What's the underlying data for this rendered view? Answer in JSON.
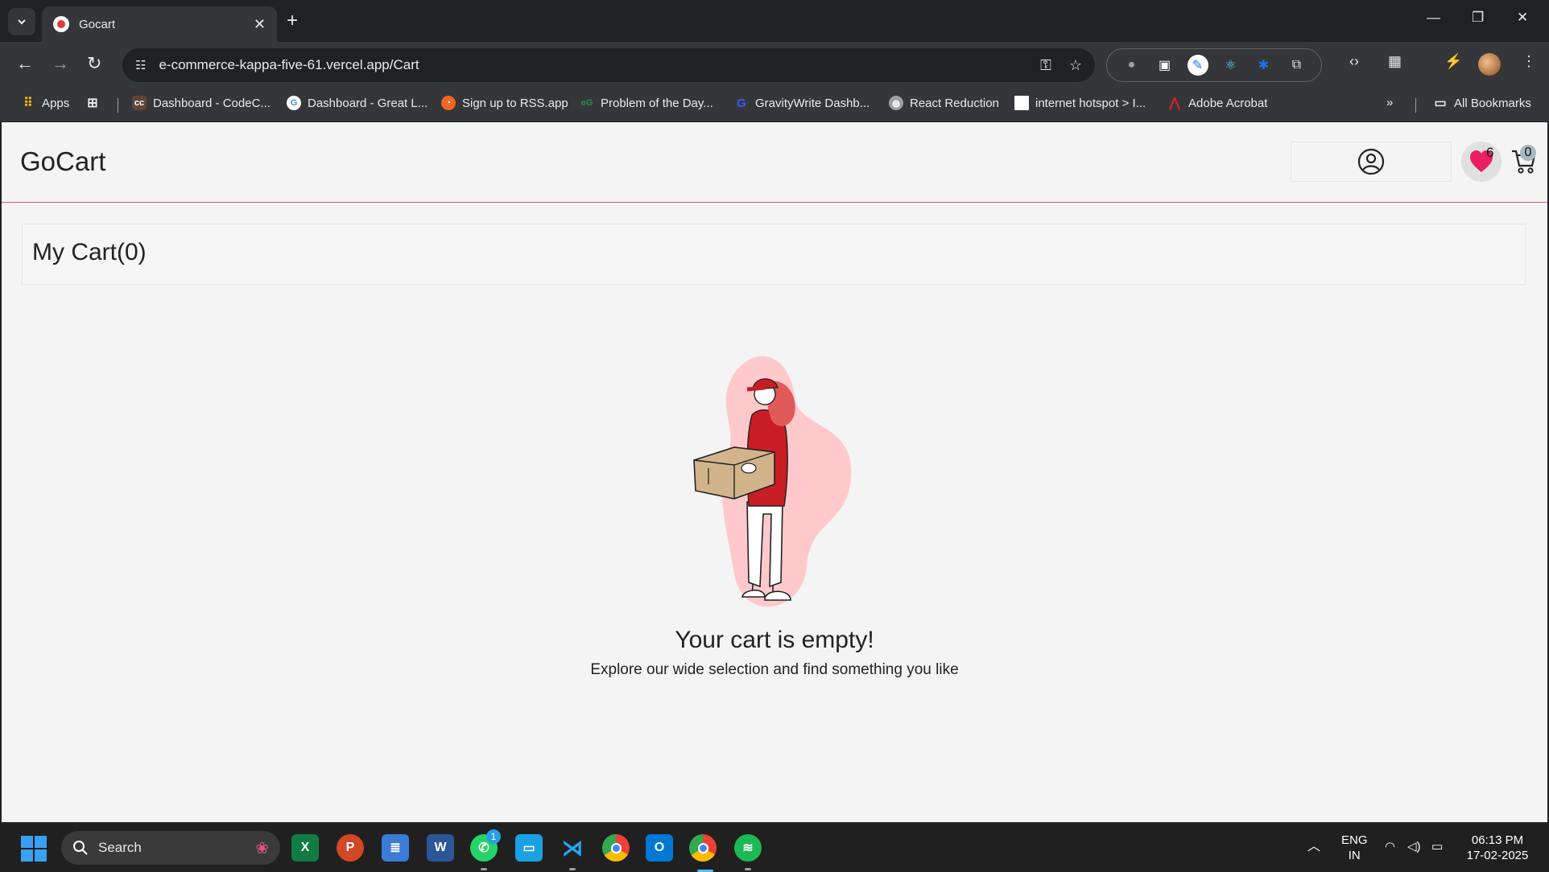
{
  "browser": {
    "tab_title": "Gocart",
    "url": "e-commerce-kappa-five-61.vercel.app/Cart",
    "bookmarks": [
      "Apps",
      "Dashboard - CodeC...",
      "Dashboard - Great L...",
      "Sign up to RSS.app",
      "Problem of the Day...",
      "GravityWrite Dashb...",
      "React Reduction",
      "internet hotspot > I...",
      "Adobe Acrobat"
    ],
    "all_bookmarks": "All Bookmarks"
  },
  "site": {
    "logo": "GoCart",
    "wishlist_count": "6",
    "cart_count": "0"
  },
  "cart": {
    "heading": "My Cart(0)",
    "empty_title": "Your cart is empty!",
    "empty_subtitle": "Explore our wide selection and find something you like"
  },
  "taskbar": {
    "search_label": "Search",
    "whatsapp_badge": "1",
    "lang_top": "ENG",
    "lang_bottom": "IN",
    "time": "06:13 PM",
    "date": "17-02-2025"
  },
  "colors": {
    "accent": "#e0557f",
    "heart": "#e91e63",
    "illustration_red": "#c81d25",
    "blob": "#ffc9cc"
  }
}
